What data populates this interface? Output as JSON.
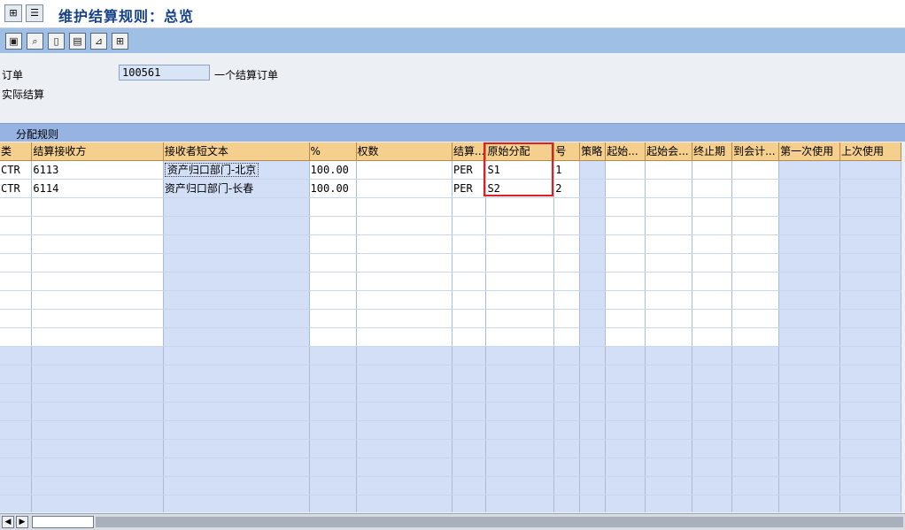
{
  "window": {
    "title": "维护结算规则：总览"
  },
  "titlebar": {
    "btn1_icon": "expand-icon",
    "btn2_icon": "menu-icon"
  },
  "toolbar": {
    "buttons": [
      {
        "icon": "overview-icon"
      },
      {
        "icon": "detail-search-icon"
      },
      {
        "icon": "new-page-icon"
      },
      {
        "icon": "delete-icon"
      },
      {
        "icon": "hierarchy-icon"
      },
      {
        "icon": "structure-icon"
      }
    ]
  },
  "header": {
    "order_label": "订单",
    "order_value": "100561",
    "order_desc": "一个结算订单",
    "actual_label": "实际结算"
  },
  "table": {
    "title": "分配规则",
    "columns": [
      "类",
      "结算接收方",
      "接收者短文本",
      "%",
      "权数",
      "结算...",
      "原始分配",
      "号",
      "策略",
      "起始...",
      "起始会...",
      "终止期",
      "到会计...",
      "第一次使用",
      "上次使用"
    ],
    "rows": [
      {
        "type": "CTR",
        "receiver": "6113",
        "short_text": "资产归口部门-北京",
        "percent": "100.00",
        "weight": "",
        "settle": "PER",
        "source": "S1",
        "no": "1"
      },
      {
        "type": "CTR",
        "receiver": "6114",
        "short_text": "资产归口部门-长春",
        "percent": "100.00",
        "weight": "",
        "settle": "PER",
        "source": "S2",
        "no": "2"
      }
    ]
  },
  "colors": {
    "title_blue": "#15408a",
    "header_orange": "#f5cf8e",
    "highlight_red": "#e02020",
    "input_blue": "#d9e5f7"
  }
}
